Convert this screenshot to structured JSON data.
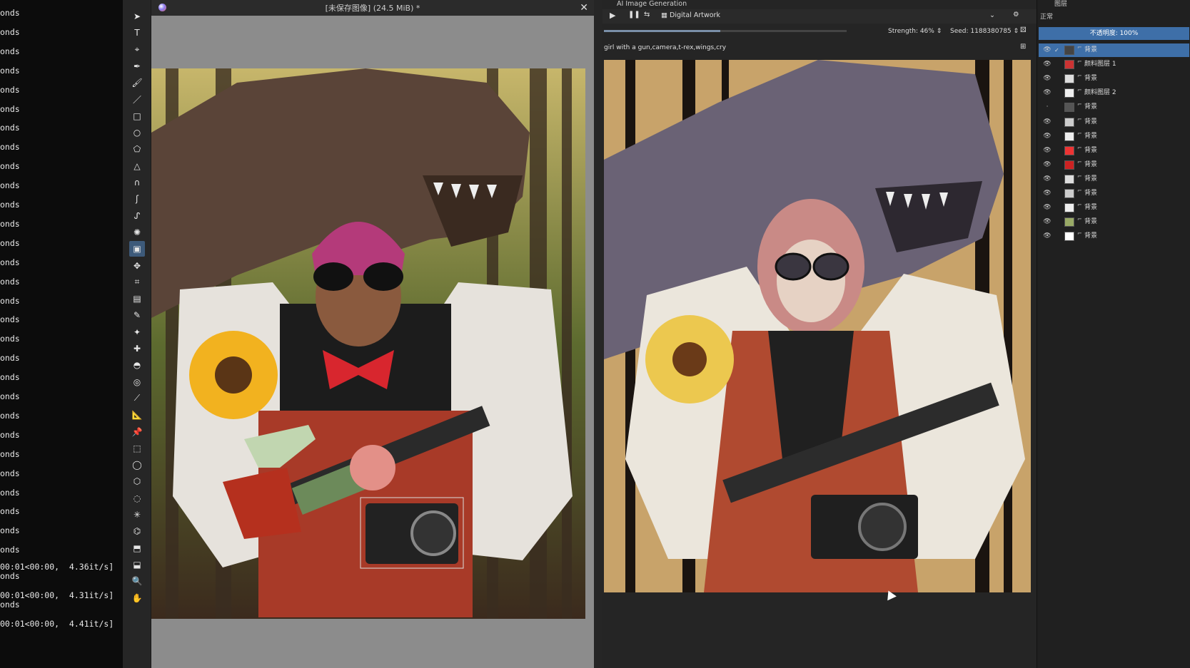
{
  "terminal": {
    "lines": [
      "onds",
      "onds",
      "onds",
      "onds",
      "onds",
      "onds",
      "onds",
      "onds",
      "onds",
      "onds",
      "onds",
      "onds",
      "onds",
      "onds",
      "onds",
      "onds",
      "onds",
      "onds",
      "onds",
      "onds",
      "onds",
      "onds",
      "onds",
      "onds",
      "onds",
      "onds",
      "onds",
      "onds",
      "onds"
    ],
    "progress_lines": [
      "00:01<00:00,  4.36it/s]",
      "onds",
      "00:01<00:00,  4.31it/s]",
      "onds",
      "00:01<00:00,  4.41it/s]"
    ]
  },
  "canvas_window": {
    "title": "[未保存图像]  (24.5 MiB) *",
    "close_label": "✕"
  },
  "ai_panel": {
    "title": "AI Image Generation",
    "style_label": "Digital Artwork",
    "strength_label": "Strength: 46%",
    "seed_label": "Seed: 1188380785",
    "prompt": "girl with a gun,camera,t-rex,wings,cry",
    "progress": 0.48
  },
  "layers_panel": {
    "title": "图层",
    "blend_mode": "正常",
    "opacity_label": "不透明度:  100%",
    "layers": [
      {
        "name": "背景",
        "visible": true,
        "selected": true
      },
      {
        "name": "颜料图层 1",
        "visible": true,
        "selected": false
      },
      {
        "name": "背景",
        "visible": true,
        "selected": false
      },
      {
        "name": "颜料图层 2",
        "visible": true,
        "selected": false
      },
      {
        "name": "背景",
        "visible": false,
        "selected": false
      },
      {
        "name": "背景",
        "visible": true,
        "selected": false
      },
      {
        "name": "背景",
        "visible": true,
        "selected": false
      },
      {
        "name": "背景",
        "visible": true,
        "selected": false
      },
      {
        "name": "背景",
        "visible": true,
        "selected": false
      },
      {
        "name": "背景",
        "visible": true,
        "selected": false
      },
      {
        "name": "背景",
        "visible": true,
        "selected": false
      },
      {
        "name": "背景",
        "visible": true,
        "selected": false
      },
      {
        "name": "背景",
        "visible": true,
        "selected": false
      },
      {
        "name": "背景",
        "visible": true,
        "selected": false
      }
    ]
  },
  "tools": [
    "select-shapes-tool",
    "text-tool",
    "edit-shapes-tool",
    "calligraphy-tool",
    "freehand-brush-tool",
    "line-tool",
    "rectangle-tool",
    "ellipse-tool",
    "polygon-tool",
    "polyline-tool",
    "bezier-curve-tool",
    "freehand-path-tool",
    "dynamic-brush-tool",
    "multibrush-tool",
    "transform-tool",
    "move-tool",
    "crop-tool",
    "gradient-tool",
    "color-sampler-tool",
    "colorize-mask-tool",
    "smart-patch-tool",
    "fill-tool",
    "enclose-fill-tool",
    "assistant-tool",
    "measure-tool",
    "reference-images-tool",
    "rectangular-selection-tool",
    "elliptical-selection-tool",
    "polygonal-selection-tool",
    "freehand-selection-tool",
    "contiguous-selection-tool",
    "similar-color-selection-tool",
    "bezier-selection-tool",
    "magnetic-selection-tool",
    "zoom-tool",
    "pan-tool"
  ]
}
